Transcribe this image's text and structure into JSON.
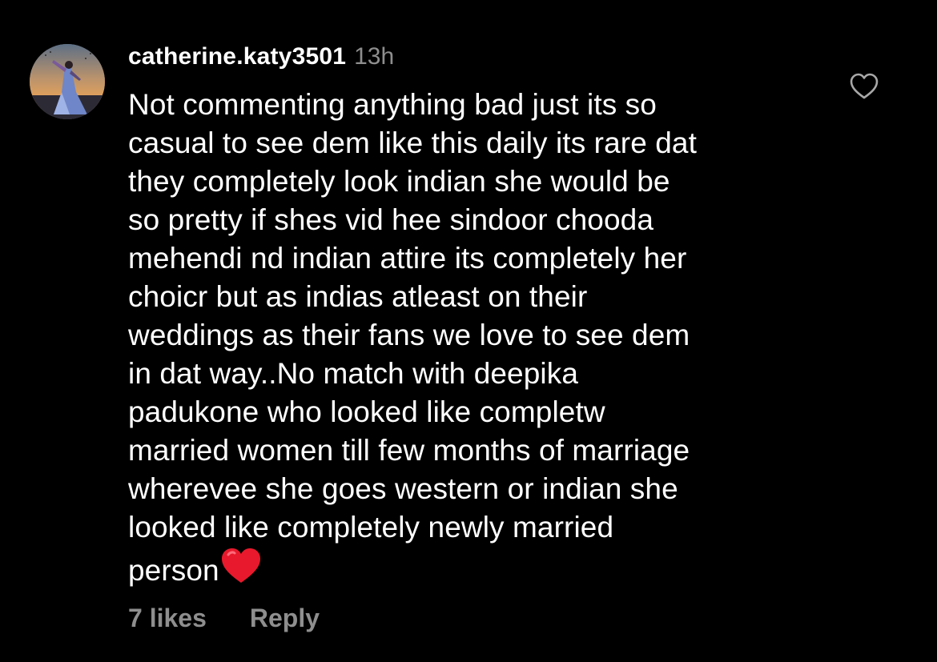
{
  "comment": {
    "username": "catherine.katy3501",
    "timestamp": "13h",
    "text": "Not commenting anything bad just its so\ncasual to see dem like this daily its rare dat\nthey completely look indian she would be\nso pretty if shes vid hee sindoor chooda\nmehendi nd indian attire its completely her\nchoicr but as indias atleast on their\nweddings as their fans we love to see dem\nin dat way..No match with deepika\npadukone who looked like completw\nmarried women till few months of marriage\nwherevee she goes western or indian she\nlooked like completely newly married\nperson",
    "emoji": "red-heart-emoji",
    "likes_label": "7 likes",
    "reply_label": "Reply",
    "like_icon": "heart-outline-icon"
  },
  "colors": {
    "background": "#000000",
    "primary_text": "#ffffff",
    "secondary_text": "#8e8e8e",
    "heart_red": "#e8192c"
  }
}
